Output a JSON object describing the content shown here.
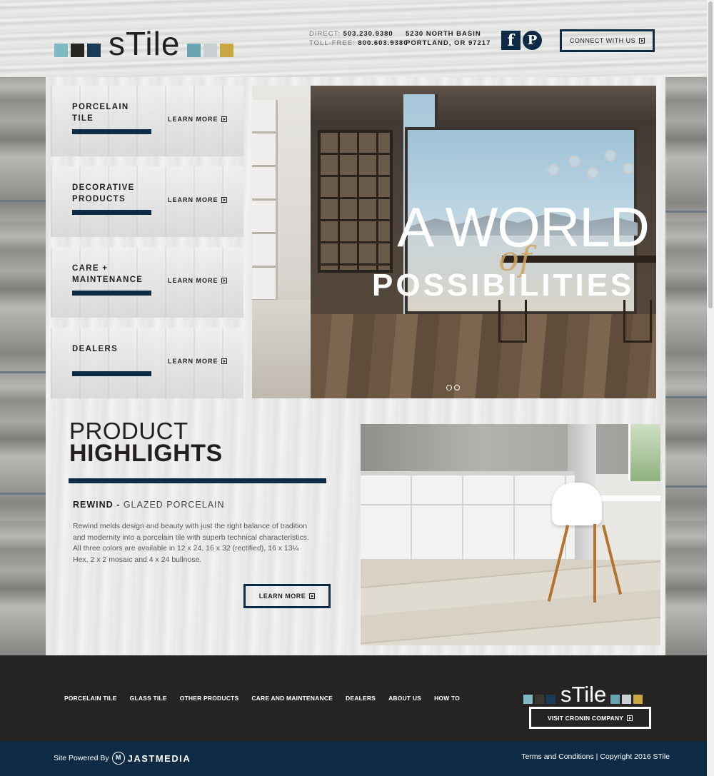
{
  "brand": {
    "name": "sTile",
    "colors": [
      "#7fb9c4",
      "#2a2622",
      "#1a3a57",
      "#7fb9c4",
      "#c9cfd3",
      "#c8a640"
    ],
    "accent": "#0d2b45"
  },
  "header": {
    "direct_label": "DIRECT:",
    "direct_phone": "503.230.9380",
    "tollfree_label": "TOLL-FREE:",
    "tollfree_phone": "800.603.9380",
    "address_line1": "5230 NORTH BASIN",
    "address_line2": "PORTLAND, OR 97217",
    "facebook_icon": "f",
    "pinterest_icon": "P",
    "connect_label": "CONNECT WITH US"
  },
  "tiles": [
    {
      "title": "PORCELAIN\nTILE",
      "link": "LEARN MORE"
    },
    {
      "title": "DECORATIVE\nPRODUCTS",
      "link": "LEARN MORE"
    },
    {
      "title": "CARE +\nMAINTENANCE",
      "link": "LEARN MORE"
    },
    {
      "title": "DEALERS",
      "link": "LEARN MORE"
    }
  ],
  "hero": {
    "line1": "A WORLD",
    "line2": "of",
    "line3": "POSSIBILITIES",
    "slides": 2
  },
  "highlights": {
    "heading1": "PRODUCT",
    "heading2": "HIGHLIGHTS",
    "product_name": "REWIND -",
    "product_type": "GLAZED PORCELAIN",
    "description": "Rewind melds design and beauty with just the right balance of tradition and modernity into a porcelain tile with superb technical characteristics. All three colors are available in 12 x 24, 16 x 32 (rectified), 16 x 13¼ Hex, 2 x 2 mosaic and 4 x 24 bullnose.",
    "button": "LEARN MORE"
  },
  "footer": {
    "nav": [
      "PORCELAIN TILE",
      "GLASS TILE",
      "OTHER PRODUCTS",
      "CARE AND MAINTENANCE",
      "DEALERS",
      "ABOUT US",
      "HOW TO"
    ],
    "visit_label": "VISIT CRONIN COMPANY",
    "powered_by": "Site Powered By",
    "powered_logo_letter": "M",
    "powered_company": "JASTMEDIA",
    "terms": "Terms and Conditions",
    "separator": "|",
    "copyright": "Copyright 2016 STile"
  }
}
